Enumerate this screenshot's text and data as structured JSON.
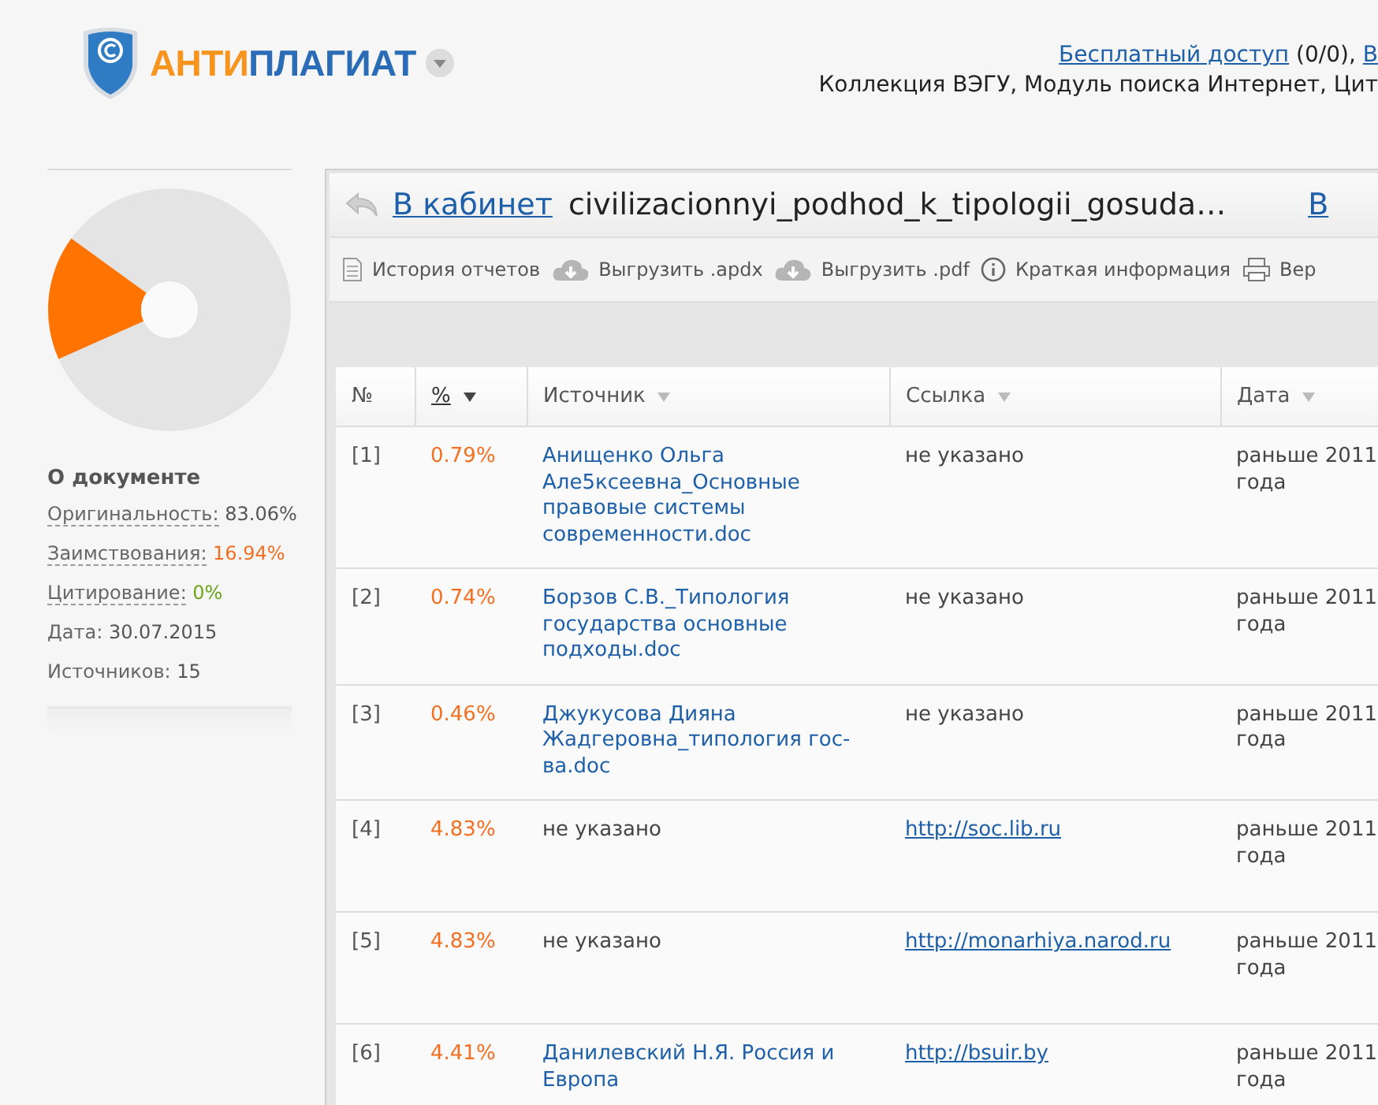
{
  "header": {
    "logo": {
      "part_1": "АНТИ",
      "part_2": "ПЛАГИАТ"
    },
    "access_link": "Бесплатный доступ",
    "access_count": "(0/0),",
    "next_link": "В",
    "collections": "Коллекция ВЭГУ, Модуль поиска Интернет, Цит"
  },
  "sidebar": {
    "title": "О документе",
    "stats": [
      {
        "label": "Оригинальность:",
        "value": "83.06%",
        "kind": "original"
      },
      {
        "label": "Заимствования:",
        "value": "16.94%",
        "kind": "borrowed"
      },
      {
        "label": "Цитирование:",
        "value": "0%",
        "kind": "citation"
      },
      {
        "label": "Дата:",
        "value": "30.07.2015",
        "kind": "plain"
      },
      {
        "label": "Источников:",
        "value": "15",
        "kind": "plain"
      }
    ]
  },
  "report": {
    "back_link": "В кабинет",
    "file_name": "civilizacionnyi_podhod_k_tipologii_gosuda…",
    "right_link": "В",
    "toolbar": [
      {
        "kind": "history",
        "label": "История отчетов"
      },
      {
        "kind": "download",
        "label": "Выгрузить .apdx"
      },
      {
        "kind": "download",
        "label": "Выгрузить .pdf"
      },
      {
        "kind": "info",
        "label": "Краткая информация"
      },
      {
        "kind": "print",
        "label": "Вер"
      }
    ],
    "table": {
      "columns": [
        {
          "label": "№",
          "sortable": false,
          "selected": false
        },
        {
          "label": "%",
          "sortable": true,
          "selected": true
        },
        {
          "label": "Источник",
          "sortable": true,
          "selected": false
        },
        {
          "label": "Ссылка",
          "sortable": true,
          "selected": false
        },
        {
          "label": "Дата",
          "sortable": true,
          "selected": false
        }
      ],
      "rows": [
        {
          "number": "[1]",
          "percent": "0.79%",
          "source": "Анищенко Ольга Але5ксеевна_Основные правовые системы современности.doc",
          "source_linked": true,
          "link": "не указано",
          "link_linked": false,
          "date": "раньше 2011 года"
        },
        {
          "number": "[2]",
          "percent": "0.74%",
          "source": "Борзов С.В._Типология государства основные подходы.doc",
          "source_linked": true,
          "link": "не указано",
          "link_linked": false,
          "date": "раньше 2011 года"
        },
        {
          "number": "[3]",
          "percent": "0.46%",
          "source": "Джукусова Дияна Жадгеровна_типология гос-ва.doc",
          "source_linked": true,
          "link": "не указано",
          "link_linked": false,
          "date": "раньше 2011 года"
        },
        {
          "number": "[4]",
          "percent": "4.83%",
          "source": "не указано",
          "source_linked": false,
          "link": "http://soc.lib.ru",
          "link_linked": true,
          "date": "раньше 2011 года"
        },
        {
          "number": "[5]",
          "percent": "4.83%",
          "source": "не указано",
          "source_linked": false,
          "link": "http://monarhiya.narod.ru",
          "link_linked": true,
          "date": "раньше 2011 года"
        },
        {
          "number": "[6]",
          "percent": "4.41%",
          "source": "Данилевский Н.Я. Россия и Европа",
          "source_linked": true,
          "link": "http://bsuir.by",
          "link_linked": true,
          "date": "раньше 2011 года"
        }
      ]
    }
  }
}
